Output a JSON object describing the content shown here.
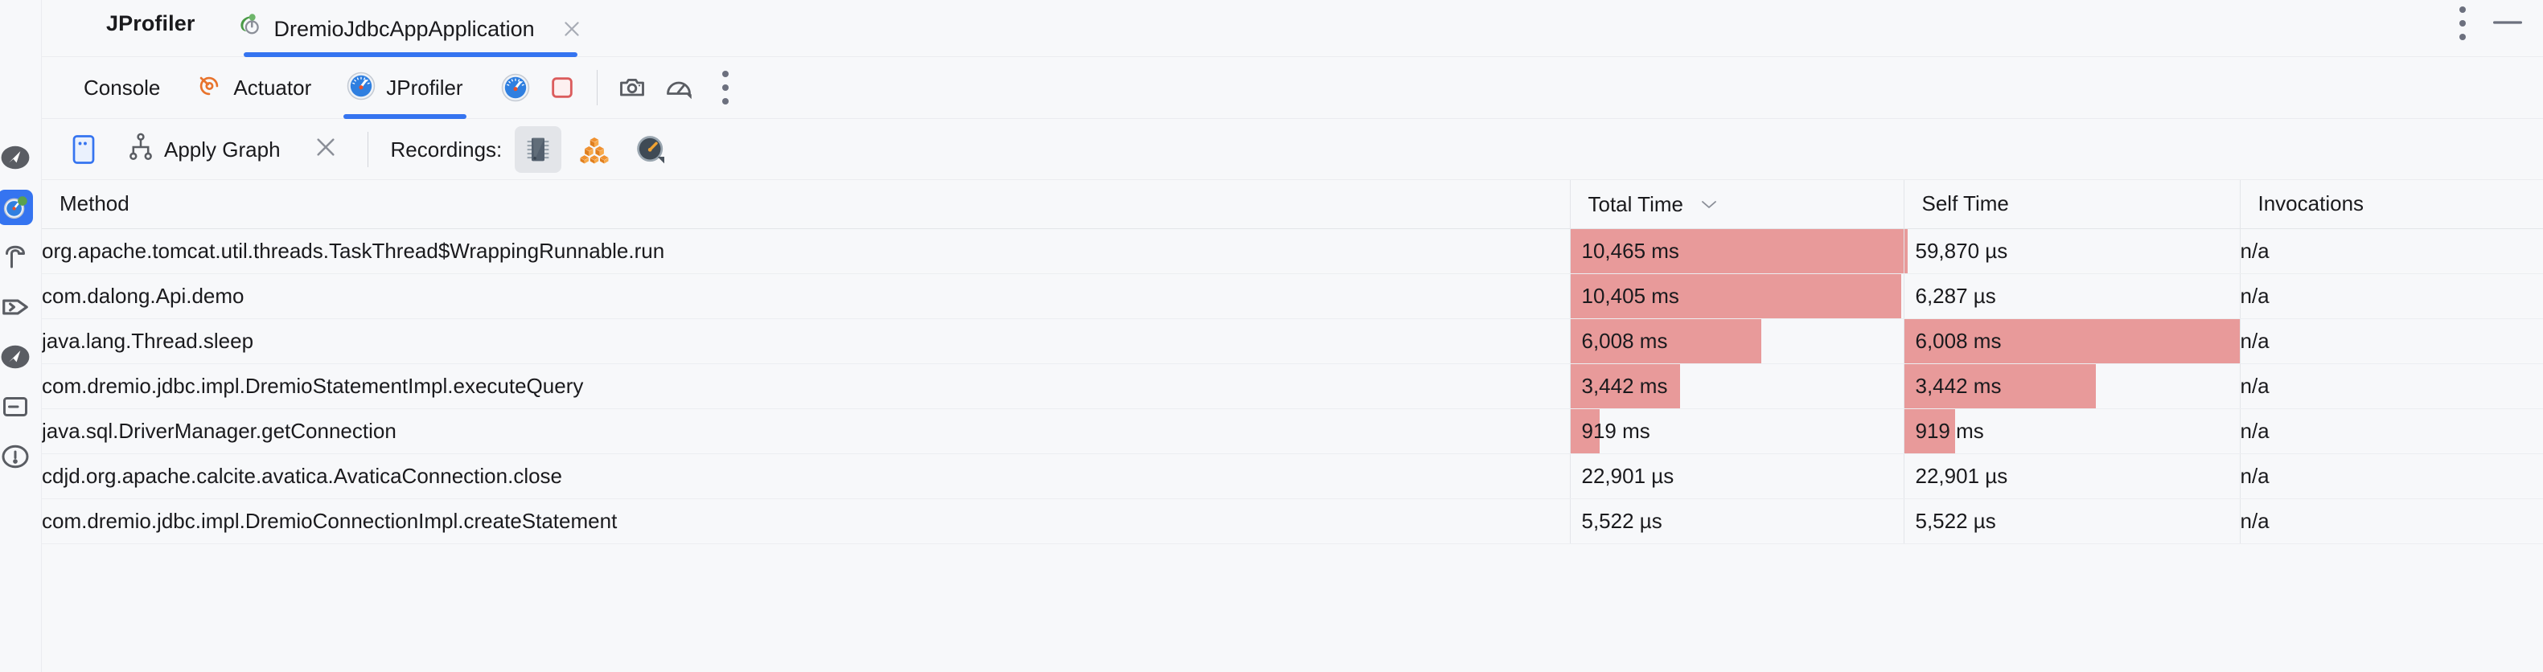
{
  "window": {
    "app_title": "JProfiler",
    "run_tab": {
      "label": "DremioJdbcAppApplication",
      "icon": "spring-boot-run-icon",
      "close_icon": "close-icon",
      "active": true
    },
    "more_icon": "vertical-ellipsis-icon",
    "minimize_icon": "minimize-icon"
  },
  "tabstrip": {
    "tabs": [
      {
        "label": "Console",
        "icon": "console-icon",
        "active": false
      },
      {
        "label": "Actuator",
        "icon": "actuator-icon",
        "active": false
      },
      {
        "label": "JProfiler",
        "icon": "jprofiler-gauge-icon",
        "active": true
      }
    ],
    "tools": [
      {
        "name": "attach-profiler-icon",
        "title": "JProfiler"
      },
      {
        "name": "stop-icon",
        "title": "Stop"
      },
      {
        "name": "camera-snapshot-icon",
        "title": "Save Snapshot"
      },
      {
        "name": "gauge-settings-icon",
        "title": "Profiling Settings"
      },
      {
        "name": "more-options-icon",
        "title": "More"
      }
    ]
  },
  "localbar": {
    "view_mode_icon": "view-mode-icon",
    "apply_graph": {
      "label": "Apply Graph",
      "icon": "graph-icon"
    },
    "clear_icon": "close-icon",
    "recordings": {
      "label": "Recordings:",
      "buttons": [
        {
          "name": "cpu-recording-icon",
          "label": "CPU",
          "active": true
        },
        {
          "name": "allocation-recording-icon",
          "label": "Allocations",
          "active": false
        },
        {
          "name": "probe-recording-icon",
          "label": "Probes",
          "active": false
        }
      ]
    }
  },
  "table": {
    "columns": [
      {
        "key": "method",
        "label": "Method",
        "sorted": false
      },
      {
        "key": "total_time",
        "label": "Total Time",
        "sorted": true,
        "sort_icon": "chevron-down-icon"
      },
      {
        "key": "self_time",
        "label": "Self Time",
        "sorted": false
      },
      {
        "key": "invocations",
        "label": "Invocations",
        "sorted": false
      }
    ],
    "bar_color": "#e89a9a",
    "rows": [
      {
        "method": "org.apache.tomcat.util.threads.TaskThread$WrappingRunnable.run",
        "total_time": "10,465 ms",
        "total_time_pct": 100,
        "self_time": "59,870 µs",
        "self_time_pct": 1.0,
        "invocations": "n/a"
      },
      {
        "method": "com.dalong.Api.demo",
        "total_time": "10,405 ms",
        "total_time_pct": 99.4,
        "self_time": "6,287 µs",
        "self_time_pct": 0.1,
        "invocations": "n/a"
      },
      {
        "method": "java.lang.Thread.sleep",
        "total_time": "6,008 ms",
        "total_time_pct": 57.4,
        "self_time": "6,008 ms",
        "self_time_pct": 100,
        "invocations": "n/a"
      },
      {
        "method": "com.dremio.jdbc.impl.DremioStatementImpl.executeQuery",
        "total_time": "3,442 ms",
        "total_time_pct": 32.9,
        "self_time": "3,442 ms",
        "self_time_pct": 57.3,
        "invocations": "n/a"
      },
      {
        "method": "java.sql.DriverManager.getConnection",
        "total_time": "919 ms",
        "total_time_pct": 8.8,
        "self_time": "919 ms",
        "self_time_pct": 15.3,
        "invocations": "n/a"
      },
      {
        "method": "cdjd.org.apache.calcite.avatica.AvaticaConnection.close",
        "total_time": "22,901 µs",
        "total_time_pct": 0,
        "self_time": "22,901 µs",
        "self_time_pct": 0,
        "invocations": "n/a"
      },
      {
        "method": "com.dremio.jdbc.impl.DremioConnectionImpl.createStatement",
        "total_time": "5,522 µs",
        "total_time_pct": 0,
        "self_time": "5,522 µs",
        "self_time_pct": 0,
        "invocations": "n/a"
      }
    ]
  },
  "rail": {
    "items": [
      {
        "name": "sidebar-item-project",
        "icon": "navigator-icon",
        "active": false
      },
      {
        "name": "sidebar-item-jprofiler",
        "icon": "jprofiler-run-icon",
        "active": true
      },
      {
        "name": "sidebar-item-build",
        "icon": "hammer-icon",
        "active": false
      },
      {
        "name": "sidebar-item-terminal",
        "icon": "terminal-icon",
        "active": false
      },
      {
        "name": "sidebar-item-navigator",
        "icon": "navigator-icon",
        "active": false
      },
      {
        "name": "sidebar-item-services",
        "icon": "services-icon",
        "active": false
      },
      {
        "name": "sidebar-item-problems",
        "icon": "problems-icon",
        "active": false
      }
    ]
  }
}
